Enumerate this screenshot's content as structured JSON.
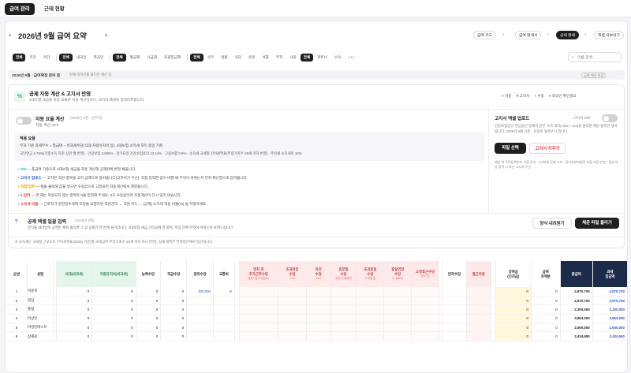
{
  "topnav": {
    "tabs": [
      "급여 관리",
      "근태 현황"
    ]
  },
  "header": {
    "title": "2026년 9월 급여 요약",
    "prev": "‹",
    "next": "›",
    "actions": [
      "급여 카드",
      "급여 명세서",
      "상세 명세",
      "엑셀 내보내기"
    ],
    "steps": [
      "1",
      "2",
      "3"
    ]
  },
  "filters": {
    "g1": [
      "전체",
      "주간",
      "야간"
    ],
    "g2": [
      "전체",
      "내국인",
      "외국인"
    ],
    "g3": [
      "전체",
      "월급제",
      "시급제",
      "포괄임금제"
    ],
    "g4": [
      "전체",
      "사무",
      "생활",
      "식당",
      "운반",
      "셔틀",
      "부자",
      "사원"
    ],
    "g5": [
      "전체",
      "파트너",
      "소속",
      "+++"
    ],
    "search_placeholder": "이름 검색"
  },
  "status_bar": {
    "date_label": "2026년 9월 · 급여확정 준비 중",
    "desc": "현재 데이터를 불러온 계산 중",
    "right": "급여 계산 마감"
  },
  "deduction": {
    "icon": "%",
    "title": "공제 자동 계산 & 고지서 반영",
    "subtitle": "4대보험 세금을 자동 요율로 자동 계산하거나, 고지서 엑셀로 업데이트합니다.",
    "legend": [
      {
        "label": "자동",
        "color": "#2bb673"
      },
      {
        "label": "고지서",
        "color": "#2a56c6"
      },
      {
        "label": "수동",
        "color": "#f0a000"
      },
      {
        "label": "외국인 확인필요",
        "color": "#e04848"
      }
    ],
    "auto_label": "자동 요율 계산",
    "auto_period": "(2026년 9월 · 일부터)",
    "auto_state": "자동 계산 OFF",
    "rate_title": "적용 요율",
    "rate_line1": "부과 기준  과세부수 = 총급여 − 비과세수당(식대·차량유지비 등). 4대보험 소득세 모두 동일 기준.",
    "rate_line2": "국민연금 4.75%(기준소득 하한·상한 월 반영) · 건강보험 3.595% · 장기요양 건강보험료의 13.14% · 고용보험 0.9% · 소득세 국세청 간이세액표(부양가족수·20세 이하 반영) · 주민세 소득세의 10%",
    "bullets": [
      {
        "b": "• ON",
        "t": " — 총급여 기준으로 4대보험·세금을 자동 계산해 공제란에 반영 채웁니다."
      },
      {
        "b": "• 고지서 업로드",
        "t": " — 고지된 직원·항목을 고지 금액으로 덮어씁니다(고지서가 우선). 직접 입력한 값이 바뀔 때 무엇이 바뀌는지 먼저 확인창으로 알려줍니다."
      },
      {
        "b": "• 직접 입력",
        "t": " — 셀을 클릭해 값을 넣으면 수동값으로 고정되어 자동계산에서 제외됩니다."
      },
      {
        "b": "• 0 입력",
        "t": " — 면 해는 적용되지 않는 항목은 0을 입력해 주세요. 0도 수동값이라 자동계산이 다시 덮지 않습니다."
      },
      {
        "b": "• 소득세 비율",
        "t": " — 근로자가 원천징수세액 조정을 요청하면 직원관리 → 직원 카드 → [공제] 소득세 적용 비율(%) 을 지정하세요."
      }
    ],
    "notice_title": "고지서 엑셀 업로드",
    "notice_state": "고지서 OFF",
    "notice_desc": "건강보험공단·연금공단 등에서 받은 고지 내역(.xlsx / .csv)을 올리면 해당 항목만 덮어씁니다. 2026년 9월 기준 · 토글로 덮어쓰기 끕니다.",
    "notice_btn1": "파일 선택",
    "notice_btn2": "고지서 지우기",
    "notice_hint": "예방 위 주민등록번호 이용 인식 · 4대보험 공제 고지 · 장기요양보험료 포함 자동 반영 · 동일 대상 중복 시 최신 고지서 우선"
  },
  "bulk": {
    "title": "공제 엑셀 일괄 입력",
    "period": "(2026년 9월)",
    "desc": "양식을 내려받아 금액만 채워 올리면 그 달 공제가 한 번에 들어갑니다. 4대보험·세금·기타공제 한 항목, 저장 전에 무엇이 바뀌는지 보여드립니다.",
    "btn1": "양식 내려받기",
    "btn2": "채운 파일 올리기"
  },
  "footnote": "※ 소득세는 국세청 근로소득 간이세액표(2026) 기준(월 과세급여·부양가족수·20세 이하 자녀 반영), 실제 세액은 연말정산에서 정산됩니다.",
  "table": {
    "headers": [
      "순번",
      "성명",
      "",
      "식대(비과세)",
      "차량유지비(비과세)",
      "능력수당",
      "직급수당",
      "관리수당",
      "교통비",
      "",
      "연차 후\n추가근무수당",
      "조과연장\n수당",
      "야간\n수당",
      "휴무일\n수당",
      "조과휴일\n수당",
      "휴일연장\n수당",
      "고정휴근수당",
      "",
      "연차수당",
      "결근차감",
      "",
      "상여금\n(인지급)",
      "급여\n차액분",
      "총급여",
      "과세\n임금액"
    ],
    "subs": [
      "",
      "",
      "",
      "",
      "",
      "",
      "",
      "",
      "",
      "",
      "통상시급×1.5(급여)",
      "×1.5",
      "×0.5",
      "포괄시간별급여",
      "×1.5(법정)",
      "×1.5(토요)",
      "위반근무",
      "",
      "",
      "",
      "",
      "",
      "",
      "",
      ""
    ],
    "rows": [
      [
        "1",
        "이윤복",
        "0",
        "0",
        "0",
        "0",
        "",
        "",
        "0",
        "2,870,700",
        "2,870,700"
      ],
      [
        "2",
        "엄남",
        "0",
        "0",
        "0",
        "0",
        "",
        "",
        "0",
        "2,570,700",
        "2,570,700"
      ],
      [
        "3",
        "홍림",
        "0",
        "0",
        "0",
        "0",
        "",
        "",
        "0",
        "2,300,000",
        "2,300,000"
      ],
      [
        "4",
        "이상민",
        "0",
        "0",
        "0",
        "0",
        "",
        "",
        "0",
        "3,953,000",
        "3,953,000"
      ],
      [
        "5",
        "마성민테스트",
        "0",
        "0",
        "0",
        "0",
        "",
        "",
        "0",
        "2,500,000",
        "2,500,000"
      ],
      [
        "6",
        "삼재윤",
        "0",
        "0",
        "0",
        "0",
        "",
        "",
        "0",
        "2,434,650",
        "2,434,650"
      ]
    ],
    "row1_mgmt": "300,000"
  }
}
